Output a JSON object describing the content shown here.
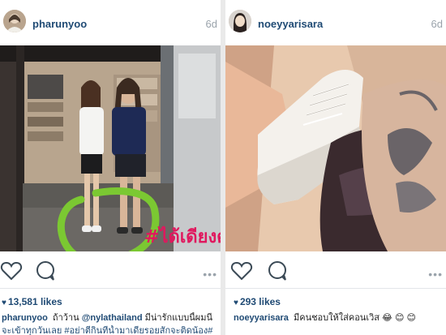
{
  "left_post": {
    "username": "pharunyoo",
    "time_ago": "6d",
    "overlay_hashtag": "#ได้เดียงดารา",
    "likes": "13,581 likes",
    "caption_user": "pharunyoo",
    "caption_text_before": "ถ้าว้าน",
    "caption_mention": "@nylathailand",
    "caption_text_after": "มีน่ารักแบบนี้ผมนี",
    "caption_line2": "จะเข้าทุกวันเลย #อย่าตีกินที่น้ำมาเดียรอยสักจะติดน้อง#"
  },
  "right_post": {
    "username": "noeyyarisara",
    "time_ago": "6d",
    "likes": "293 likes",
    "caption_user": "noeyyarisara",
    "caption_text": "มีคนชอบให้ใส่คอนเวิส",
    "emojis": [
      "😂",
      "😊",
      "😊"
    ]
  },
  "icons": {
    "like": "heart-outline-icon",
    "comment": "speech-bubble-icon",
    "more": "more-dots-icon",
    "likes_heart": "small-heart-icon"
  },
  "colors": {
    "username": "#1f4a74",
    "timestamp": "#9aa3ab",
    "hashtag_overlay": "#e0185e",
    "circle_annotation": "#7bc832"
  }
}
